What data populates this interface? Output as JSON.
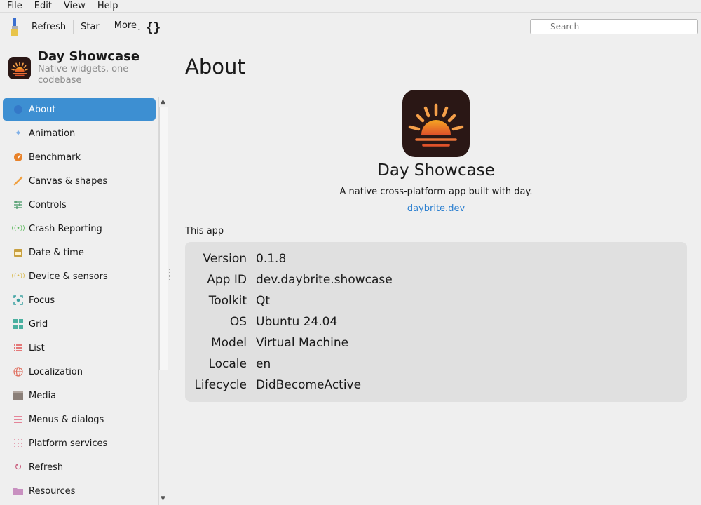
{
  "menubar": {
    "items": [
      "File",
      "Edit",
      "View",
      "Help"
    ]
  },
  "toolbar": {
    "refresh_label": "Refresh",
    "star_label": "Star",
    "more_label": "More",
    "braces_label": "{}",
    "search_placeholder": "Search"
  },
  "app": {
    "name": "Day Showcase",
    "tagline": "Native widgets, one codebase"
  },
  "sidebar": {
    "items": [
      {
        "label": "About",
        "icon": "globe-icon",
        "color": "#3478c8",
        "active": true
      },
      {
        "label": "Animation",
        "icon": "sparkle-icon",
        "color": "#7fb0e8"
      },
      {
        "label": "Benchmark",
        "icon": "gauge-icon",
        "color": "#e8822a"
      },
      {
        "label": "Canvas & shapes",
        "icon": "brush-icon",
        "color": "#f0a040"
      },
      {
        "label": "Controls",
        "icon": "sliders-icon",
        "color": "#4a9a6a"
      },
      {
        "label": "Crash Reporting",
        "icon": "signal-icon",
        "color": "#5cb85c"
      },
      {
        "label": "Date & time",
        "icon": "calendar-icon",
        "color": "#c8a040"
      },
      {
        "label": "Device & sensors",
        "icon": "sensor-icon",
        "color": "#d8b84a"
      },
      {
        "label": "Focus",
        "icon": "focus-icon",
        "color": "#3aa0a0"
      },
      {
        "label": "Grid",
        "icon": "grid-icon",
        "color": "#4ab0a0"
      },
      {
        "label": "List",
        "icon": "list-icon",
        "color": "#e05050"
      },
      {
        "label": "Localization",
        "icon": "globe-outline-icon",
        "color": "#e07060"
      },
      {
        "label": "Media",
        "icon": "clapper-icon",
        "color": "#8a7f78"
      },
      {
        "label": "Menus & dialogs",
        "icon": "menu-icon",
        "color": "#e0607a"
      },
      {
        "label": "Platform services",
        "icon": "dots-grid-icon",
        "color": "#e08aa0"
      },
      {
        "label": "Refresh",
        "icon": "refresh-icon",
        "color": "#c85a7a"
      },
      {
        "label": "Resources",
        "icon": "folder-icon",
        "color": "#c890c0"
      }
    ]
  },
  "main": {
    "title": "About",
    "app_title": "Day Showcase",
    "description": "A native cross-platform app built with day.",
    "link": "daybrite.dev",
    "section_label": "This app",
    "info": [
      {
        "key": "Version",
        "value": "0.1.8"
      },
      {
        "key": "App ID",
        "value": "dev.daybrite.showcase"
      },
      {
        "key": "Toolkit",
        "value": "Qt"
      },
      {
        "key": "OS",
        "value": "Ubuntu 24.04"
      },
      {
        "key": "Model",
        "value": "Virtual Machine"
      },
      {
        "key": "Locale",
        "value": "en"
      },
      {
        "key": "Lifecycle",
        "value": "DidBecomeActive"
      }
    ]
  },
  "colors": {
    "accent": "#3d8fd2",
    "link": "#2b7fd0",
    "logo_bg": "#2a1715",
    "sun_top": "#f5a623",
    "sun_bottom": "#e0522a"
  }
}
